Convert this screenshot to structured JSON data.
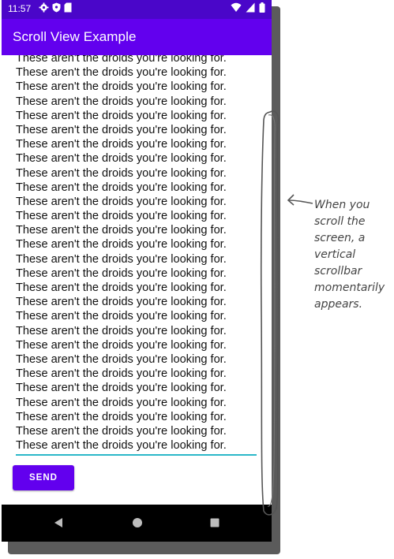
{
  "status_bar": {
    "time": "11:57",
    "left_icons": [
      "gear-icon",
      "shield-icon",
      "sd-card-icon"
    ],
    "right_icons": [
      "wifi-icon",
      "cellular-signal-icon",
      "battery-icon"
    ]
  },
  "app_bar": {
    "title": "Scroll View Example",
    "color": "#6200ee"
  },
  "scroll_view": {
    "lines": [
      "These aren't the droids you're looking for.",
      "These aren't the droids you're looking for.",
      "These aren't the droids you're looking for.",
      "These aren't the droids you're looking for.",
      "These aren't the droids you're looking for.",
      "These aren't the droids you're looking for.",
      "These aren't the droids you're looking for.",
      "These aren't the droids you're looking for.",
      "These aren't the droids you're looking for.",
      "These aren't the droids you're looking for.",
      "These aren't the droids you're looking for.",
      "These aren't the droids you're looking for.",
      "These aren't the droids you're looking for.",
      "These aren't the droids you're looking for.",
      "These aren't the droids you're looking for.",
      "These aren't the droids you're looking for.",
      "These aren't the droids you're looking for.",
      "These aren't the droids you're looking for.",
      "These aren't the droids you're looking for.",
      "These aren't the droids you're looking for.",
      "These aren't the droids you're looking for.",
      "These aren't the droids you're looking for.",
      "These aren't the droids you're looking for.",
      "These aren't the droids you're looking for.",
      "These aren't the droids you're looking for.",
      "These aren't the droids you're looking for.",
      "These aren't the droids you're looking for.",
      "These aren't the droids you're looking for."
    ]
  },
  "send_button": {
    "label": "SEND"
  },
  "nav_bar": {
    "icons": [
      "back-triangle-icon",
      "home-circle-icon",
      "overview-square-icon"
    ]
  },
  "annotation": {
    "lines": [
      "When you",
      "scroll the",
      "screen, a",
      "vertical",
      "scrollbar",
      "momentarily",
      "appears."
    ]
  }
}
